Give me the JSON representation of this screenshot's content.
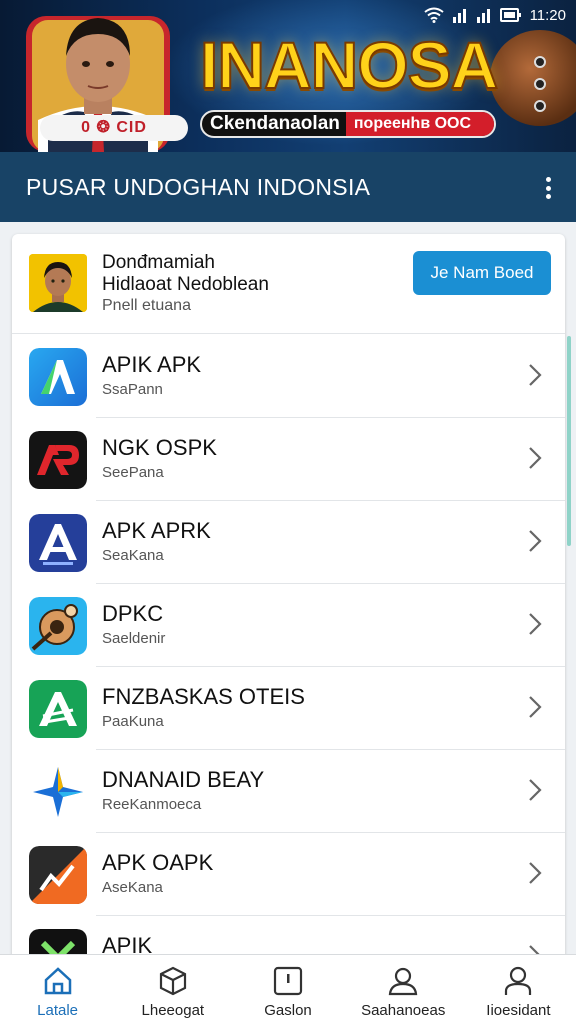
{
  "status_bar": {
    "time": "11:20"
  },
  "banner": {
    "portrait_badge": "0 ❂ CID",
    "title": "INANOSA",
    "tagline_left": "Ckendanaolan",
    "tagline_right": "пореенhв ООС"
  },
  "appbar": {
    "title": "PUSAR UNDOGHAN INDONSIA"
  },
  "featured": {
    "title_line1": "Donđmamiah",
    "title_line2": "Hidlaoat Nedoblean",
    "subtitle": "Pnell etuana",
    "button_label": "Je Nam Boed"
  },
  "apps": [
    {
      "title": "APIK APK",
      "subtitle": "SsaPann",
      "icon": "azure-a-icon"
    },
    {
      "title": "NGK OSPK",
      "subtitle": "SeePana",
      "icon": "red-ap-icon"
    },
    {
      "title": "APK APRK",
      "subtitle": "SeaKana",
      "icon": "blue-a-icon"
    },
    {
      "title": "DPKC",
      "subtitle": "Saeldenir",
      "icon": "cartoon-icon"
    },
    {
      "title": "FNZBASKAS OTEIS",
      "subtitle": "PaaKuna",
      "icon": "green-a-icon"
    },
    {
      "title": "DNANAID BEAY",
      "subtitle": "ReeKanmoeca",
      "icon": "star-icon"
    },
    {
      "title": "APK OAPK",
      "subtitle": "AseKana",
      "icon": "orange-a-icon"
    },
    {
      "title": "APIK",
      "subtitle": "",
      "icon": "dark-x-icon"
    }
  ],
  "bottom_nav": [
    {
      "label": "Latale",
      "icon": "home-icon",
      "active": true
    },
    {
      "label": "Lheeogat",
      "icon": "box-icon",
      "active": false
    },
    {
      "label": "Gaslon",
      "icon": "notice-icon",
      "active": false
    },
    {
      "label": "Saahanoeas",
      "icon": "user-outline-icon",
      "active": false
    },
    {
      "label": "Iioesidant",
      "icon": "person-icon",
      "active": false
    }
  ],
  "colors": {
    "appbar": "#184366",
    "button": "#1b8fd3",
    "active_nav": "#1b6fb8",
    "banner_title": "#ffd21a"
  }
}
